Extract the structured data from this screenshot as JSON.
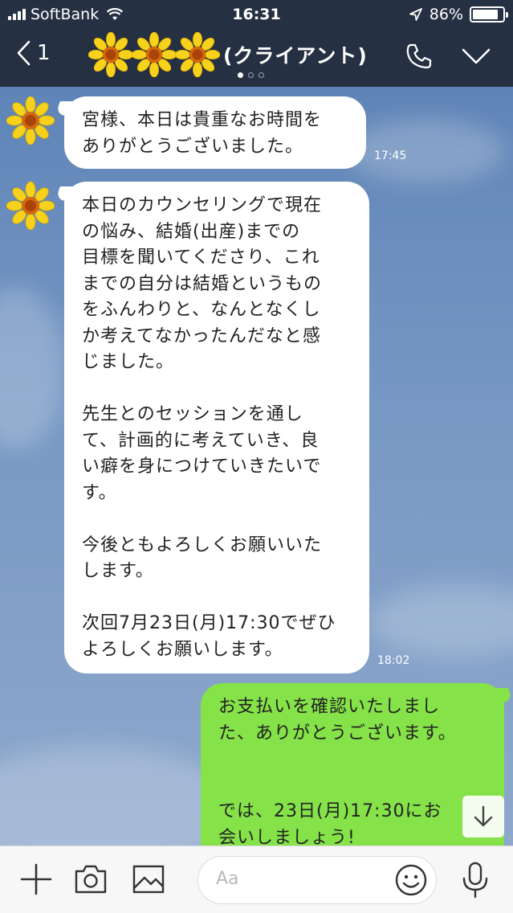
{
  "status": {
    "carrier": "SoftBank",
    "time": "16:31",
    "battery": "86%",
    "battery_level": 0.86
  },
  "header": {
    "back_count": "1",
    "title": "(クライアント)"
  },
  "messages": [
    {
      "direction": "in",
      "text": "宮様、本日は貴重なお時間を\nありがとうございました。",
      "time": "17:45"
    },
    {
      "direction": "in",
      "text": "本日のカウンセリングで現在\nの悩み、結婚(出産)までの\n目標を聞いてくださり、これ\nまでの自分は結婚というもの\nをふんわりと、なんとなくし\nか考えてなかったんだなと感\nじました。\n\n先生とのセッションを通し\nて、計画的に考えていき、良\nい癖を身につけていきたいで\nす。\n\n今後ともよろしくお願いいた\nします。\n\n次回7月23日(月)17:30でぜひ\nよろしくお願いします。",
      "time": "18:02"
    },
    {
      "direction": "out",
      "text": "お支払いを確認いたしまし\nた、ありがとうございます。\n\n\nでは、23日(月)17:30にお\n会いしましょう!",
      "time": ""
    }
  ],
  "input": {
    "placeholder": "Aa"
  },
  "colors": {
    "header_bg": "#253043",
    "outgoing_bubble": "#85e249",
    "incoming_bubble": "#ffffff",
    "chat_bg": "#6d8fbd"
  }
}
